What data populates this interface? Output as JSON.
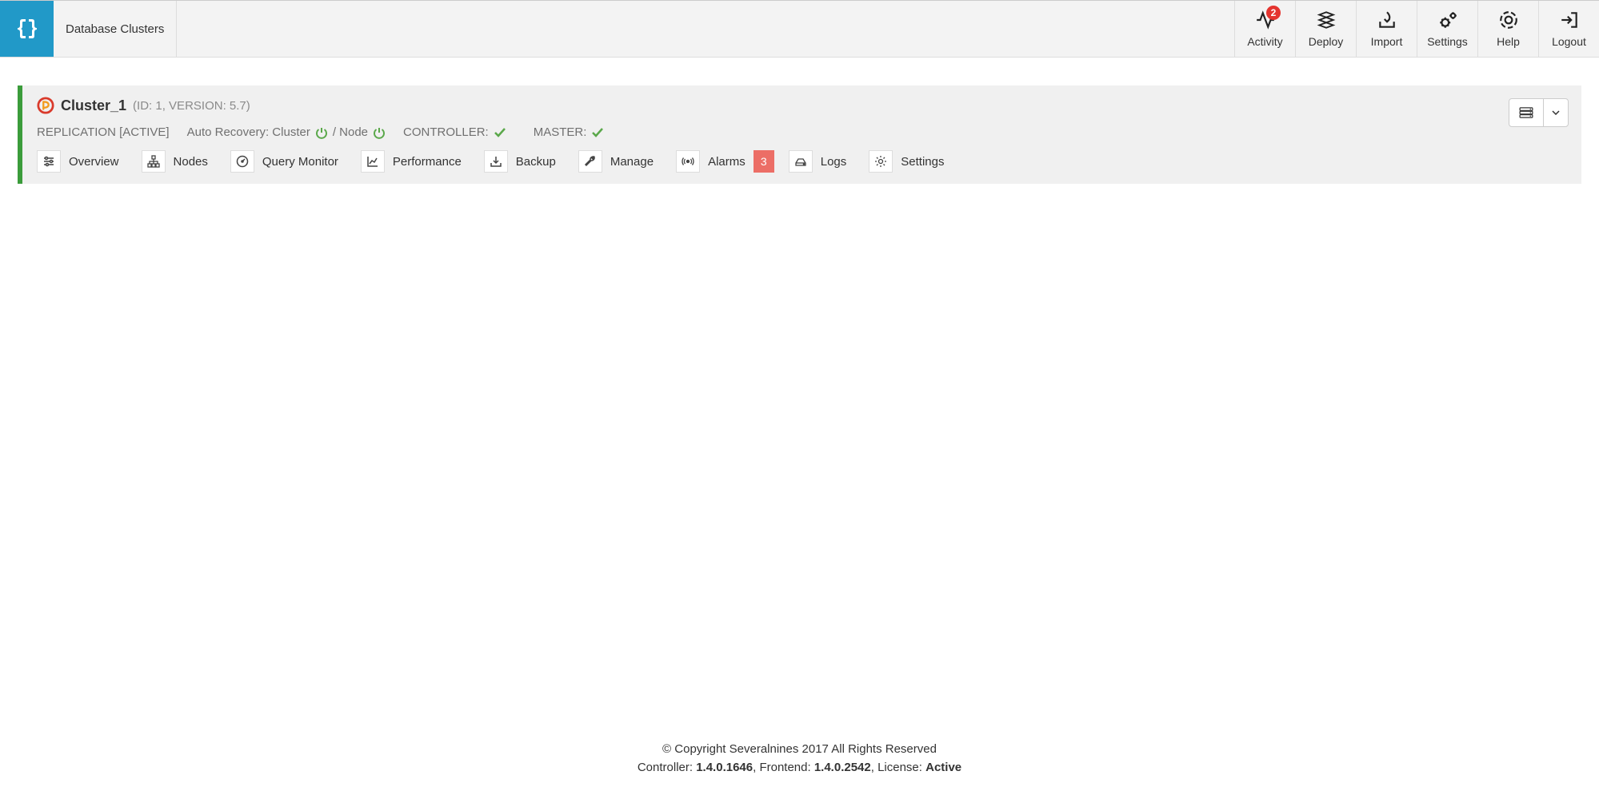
{
  "header": {
    "title": "Database Clusters",
    "nav": [
      {
        "label": "Activity",
        "badge": "2"
      },
      {
        "label": "Deploy"
      },
      {
        "label": "Import"
      },
      {
        "label": "Settings"
      },
      {
        "label": "Help"
      },
      {
        "label": "Logout"
      }
    ]
  },
  "cluster": {
    "name": "Cluster_1",
    "meta": "(ID: 1, VERSION: 5.7)",
    "status": {
      "replication": "REPLICATION [ACTIVE]",
      "auto_recovery_prefix": "Auto Recovery: Cluster",
      "auto_recovery_sep": "/ Node",
      "controller_label": "CONTROLLER:",
      "master_label": "MASTER:"
    },
    "tabs": [
      {
        "label": "Overview"
      },
      {
        "label": "Nodes"
      },
      {
        "label": "Query Monitor"
      },
      {
        "label": "Performance"
      },
      {
        "label": "Backup"
      },
      {
        "label": "Manage"
      },
      {
        "label": "Alarms",
        "badge": "3"
      },
      {
        "label": "Logs"
      },
      {
        "label": "Settings"
      }
    ]
  },
  "footer": {
    "copyright": "© Copyright Severalnines 2017 All Rights Reserved",
    "controller_label": "Controller: ",
    "controller_ver": "1.4.0.1646",
    "frontend_label": ", Frontend: ",
    "frontend_ver": "1.4.0.2542",
    "license_label": ", License: ",
    "license_val": "Active"
  }
}
